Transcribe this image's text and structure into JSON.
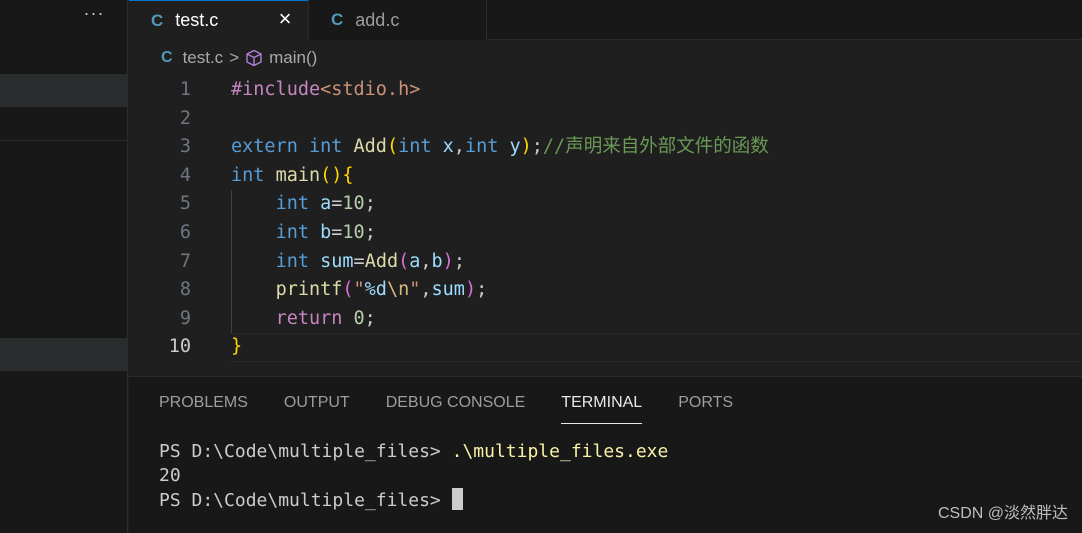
{
  "sidebar": {
    "more_label": "···"
  },
  "tabs": [
    {
      "label": "test.c",
      "active": true
    },
    {
      "label": "add.c",
      "active": false
    }
  ],
  "file_icon": "C",
  "breadcrumb": {
    "file": "test.c",
    "separator": ">",
    "symbol": "main()"
  },
  "editor": {
    "line_numbers": [
      "1",
      "2",
      "3",
      "4",
      "5",
      "6",
      "7",
      "8",
      "9",
      "10"
    ],
    "current_line": "10",
    "lines": [
      "#include<stdio.h>",
      "",
      "extern int Add(int x,int y);//声明来自外部文件的函数",
      "int main(){",
      "    int a=10;",
      "    int b=10;",
      "    int sum=Add(a,b);",
      "    printf(\"%d\\n\",sum);",
      "    return 0;",
      "}"
    ]
  },
  "panel": {
    "tabs": [
      "PROBLEMS",
      "OUTPUT",
      "DEBUG CONSOLE",
      "TERMINAL",
      "PORTS"
    ],
    "active_tab": "TERMINAL"
  },
  "terminal": {
    "prompt": "PS D:\\Code\\multiple_files> ",
    "command": ".\\multiple_files.exe",
    "output": "20"
  },
  "watermark": "CSDN @淡然胖达",
  "colors": {
    "accent": "#0078d4",
    "c_icon": "#519aba",
    "keyword": "#569cd6",
    "function": "#dcdcaa",
    "comment": "#6a9955"
  }
}
